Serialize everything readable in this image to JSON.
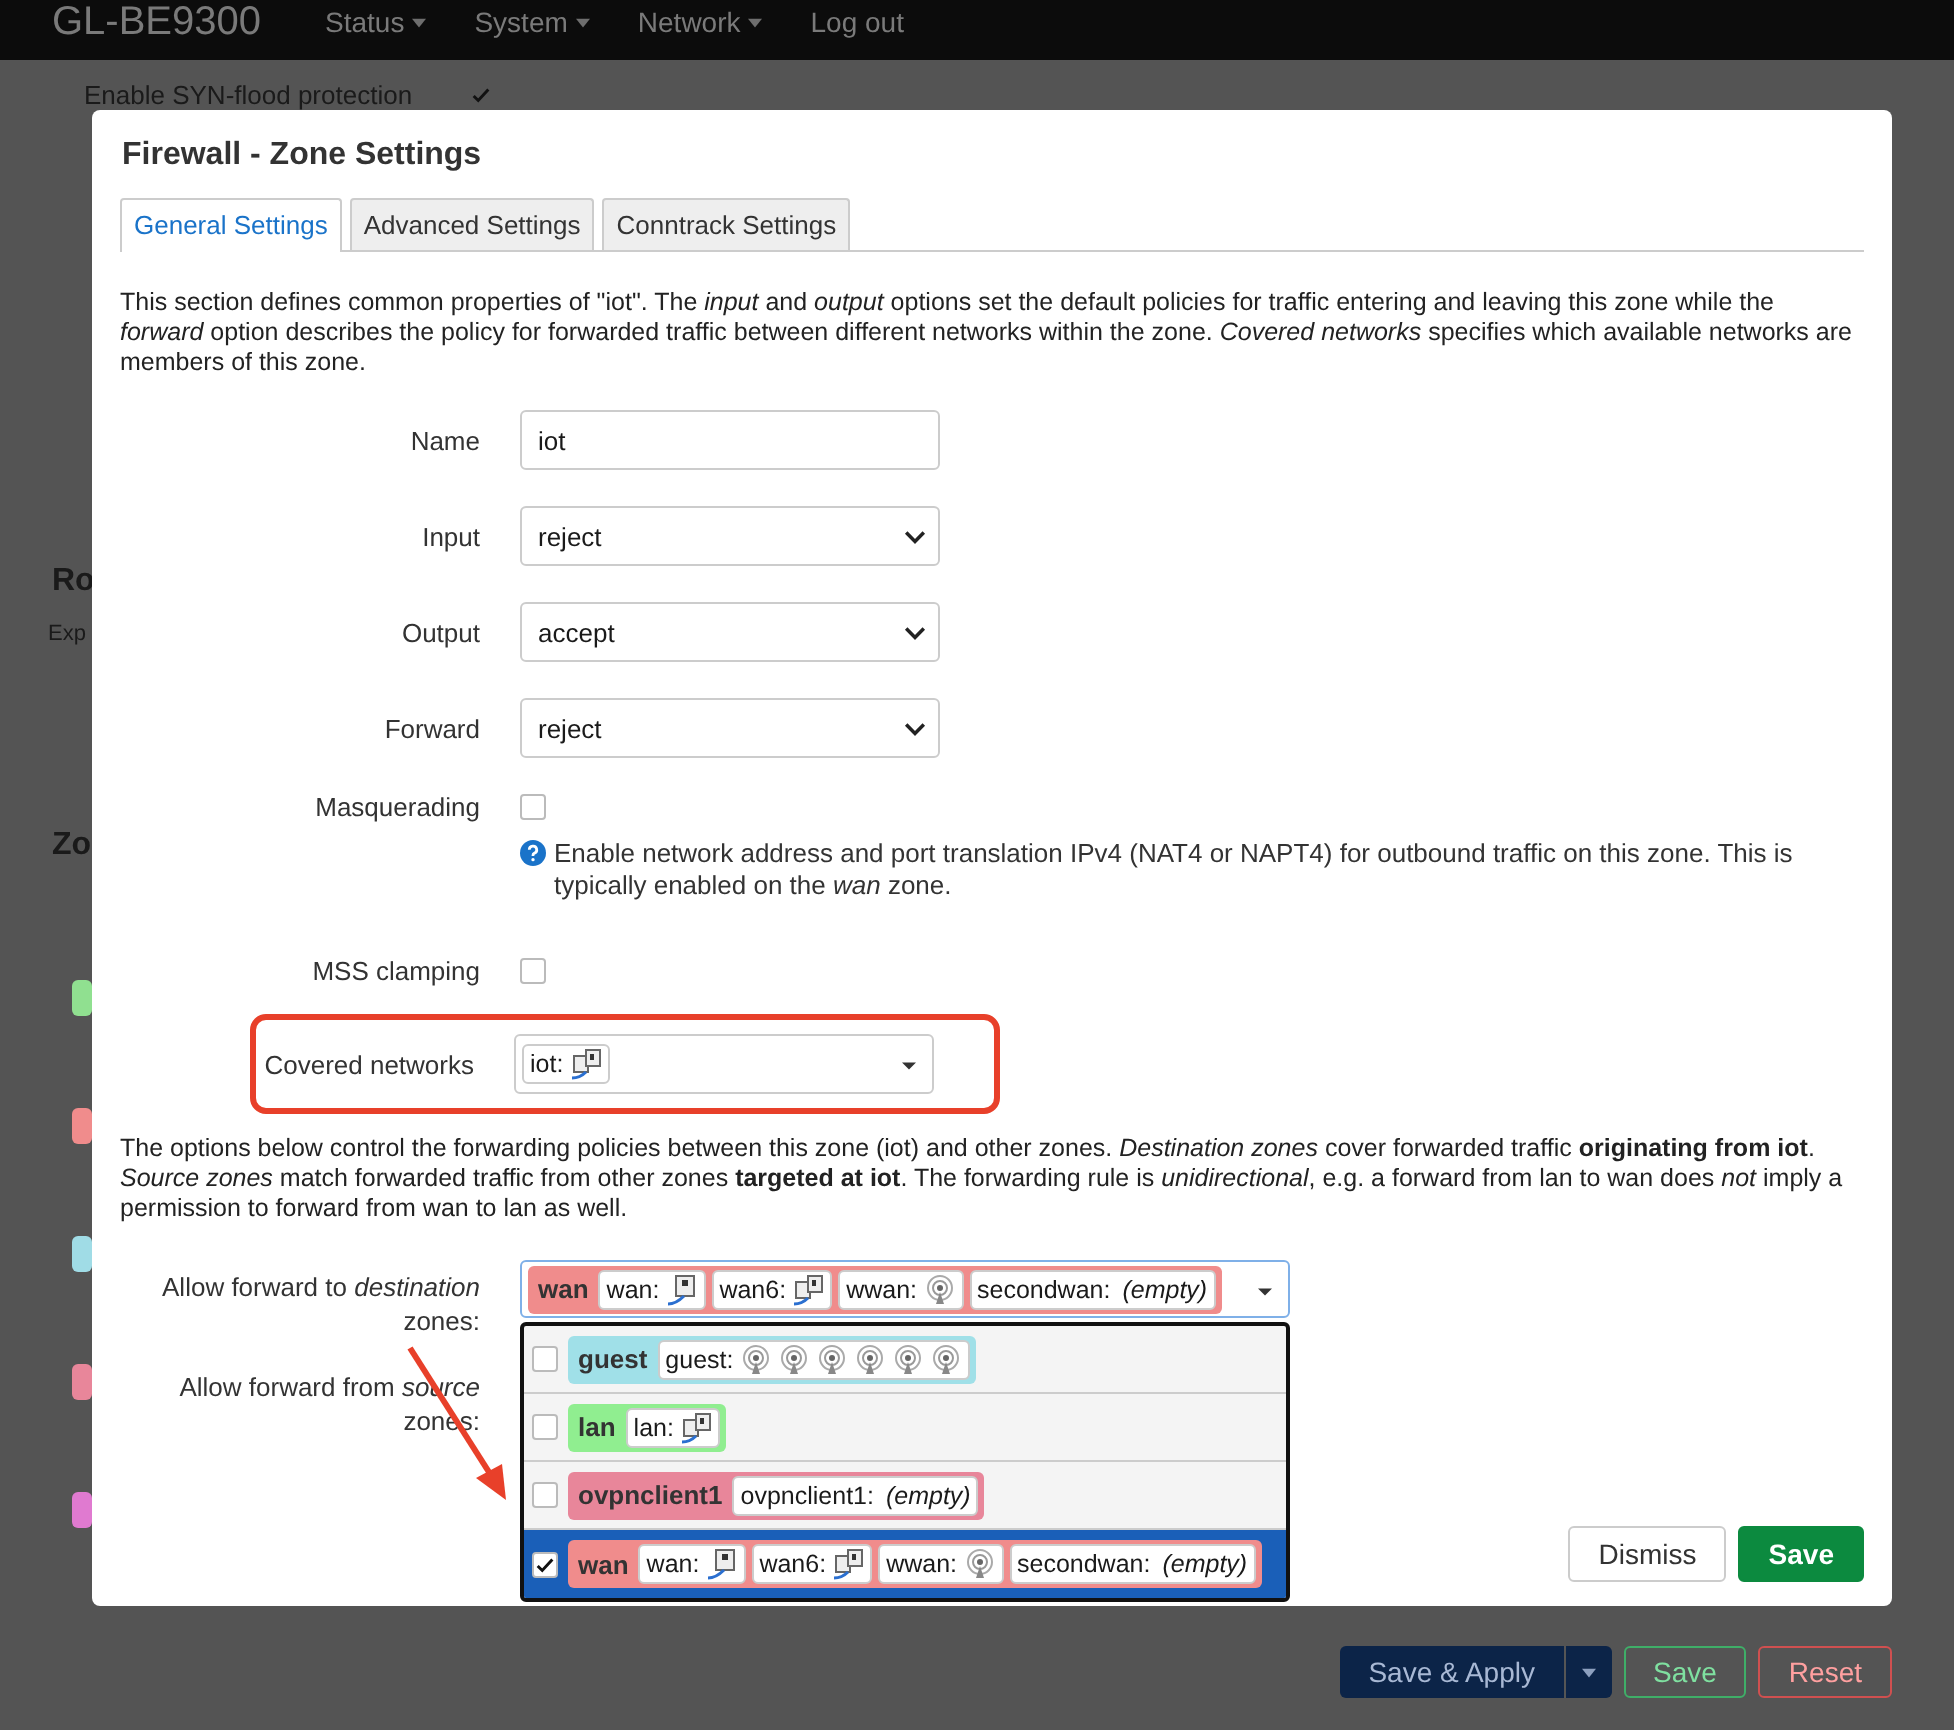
{
  "header": {
    "logo": "GL-BE9300",
    "nav": [
      {
        "label": "Status",
        "dropdown": true
      },
      {
        "label": "System",
        "dropdown": true
      },
      {
        "label": "Network",
        "dropdown": true
      },
      {
        "label": "Log out",
        "dropdown": false
      }
    ]
  },
  "background": {
    "syn_flood": {
      "label": "Enable SYN-flood protection",
      "checked": true
    },
    "heading_1": "Ro",
    "text_1": "Exp",
    "heading_2": "Zo",
    "badges": [
      {
        "color": "#90e090"
      },
      {
        "color": "#f08c8c"
      },
      {
        "color": "#a0dce6"
      },
      {
        "color": "#e8869a"
      },
      {
        "color": "#e07ad0"
      }
    ],
    "buttons": [
      {
        "kind": "split",
        "label": "Save & Apply"
      },
      {
        "kind": "positive",
        "label": "Save"
      },
      {
        "kind": "negative",
        "label": "Reset"
      }
    ]
  },
  "modal": {
    "title": "Firewall - Zone Settings",
    "tabs": [
      {
        "label": "General Settings",
        "selected": true
      },
      {
        "label": "Advanced Settings",
        "selected": false
      },
      {
        "label": "Conntrack Settings",
        "selected": false
      }
    ],
    "description": "This section defines common properties of \"iot\". The *input* and *output* options set the default policies for traffic entering and leaving this zone while the *forward* option describes the policy for forwarded traffic between different networks within the zone. *Covered networks* specifies which available networks are members of this zone.",
    "fields": [
      {
        "kind": "text",
        "label": "Name",
        "value": "iot"
      },
      {
        "kind": "select",
        "label": "Input",
        "value": "reject"
      },
      {
        "kind": "select",
        "label": "Output",
        "value": "accept"
      },
      {
        "kind": "select",
        "label": "Forward",
        "value": "reject"
      },
      {
        "kind": "checkbox",
        "label": "Masquerading",
        "checked": false,
        "help": "Enable network address and port translation IPv4 (NAT4 or NAPT4) for outbound traffic on this zone. This is typically enabled on the *wan* zone."
      },
      {
        "kind": "checkbox",
        "label": "MSS clamping",
        "checked": false
      },
      {
        "kind": "networks",
        "label": "Covered networks",
        "highlighted": true,
        "networks": [
          {
            "name": "iot:",
            "devices": [
              {
                "kind": "bridge"
              }
            ]
          }
        ]
      }
    ],
    "forwarding_description": "The options below control the forwarding policies between this zone (iot) and other zones. *Destination zones* cover forwarded traffic **originating from iot**. *Source zones* match forwarded traffic from other zones **targeted at iot**. The forwarding rule is *unidirectional*, e.g. a forward from lan to wan does *not* imply a permission to forward from wan to lan as well.",
    "forward_to": {
      "label": "Allow forward to *destination* zones:",
      "selected_zones": [
        {
          "zone": "wan",
          "color": "#f08c8c",
          "networks": [
            {
              "name": "wan:",
              "devices": [
                {
                  "kind": "ethernet"
                }
              ]
            },
            {
              "name": "wan6:",
              "devices": [
                {
                  "kind": "bridge"
                }
              ]
            },
            {
              "name": "wwan:",
              "devices": [
                {
                  "kind": "wifi"
                }
              ]
            },
            {
              "name": "secondwan:",
              "empty": "(empty)"
            }
          ]
        }
      ],
      "options": [
        {
          "zone": "guest",
          "color": "#a0e0e8",
          "checked": false,
          "selected": false,
          "networks": [
            {
              "name": "guest:",
              "devices": [
                {
                  "kind": "wifi"
                },
                {
                  "kind": "wifi"
                },
                {
                  "kind": "wifi"
                },
                {
                  "kind": "wifi"
                },
                {
                  "kind": "wifi"
                },
                {
                  "kind": "wifi"
                }
              ]
            }
          ]
        },
        {
          "zone": "lan",
          "color": "#90ee90",
          "checked": false,
          "selected": false,
          "networks": [
            {
              "name": "lan:",
              "devices": [
                {
                  "kind": "bridge"
                }
              ]
            }
          ]
        },
        {
          "zone": "ovpnclient1",
          "color": "#e8869a",
          "checked": false,
          "selected": false,
          "networks": [
            {
              "name": "ovpnclient1:",
              "empty": "(empty)"
            }
          ]
        },
        {
          "zone": "wan",
          "color": "#f08c8c",
          "checked": true,
          "selected": true,
          "networks": [
            {
              "name": "wan:",
              "devices": [
                {
                  "kind": "ethernet"
                }
              ]
            },
            {
              "name": "wan6:",
              "devices": [
                {
                  "kind": "bridge"
                }
              ]
            },
            {
              "name": "wwan:",
              "devices": [
                {
                  "kind": "wifi"
                }
              ]
            },
            {
              "name": "secondwan:",
              "empty": "(empty)"
            }
          ]
        }
      ]
    },
    "forward_from": {
      "label": "Allow forward from *source* zones:"
    },
    "buttons": [
      {
        "kind": "neutral",
        "label": "Dismiss"
      },
      {
        "kind": "positive",
        "label": "Save"
      }
    ]
  }
}
